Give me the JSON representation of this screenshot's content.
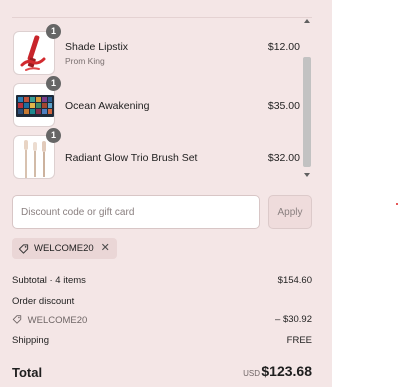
{
  "items": [
    {
      "title": "Shade Lipstix",
      "subtitle": "Prom King",
      "price": "$12.00",
      "quantity": "1"
    },
    {
      "title": "Ocean Awakening",
      "subtitle": "",
      "price": "$35.00",
      "quantity": "1"
    },
    {
      "title": "Radiant Glow Trio Brush Set",
      "subtitle": "",
      "price": "$32.00",
      "quantity": "1"
    }
  ],
  "discount": {
    "placeholder": "Discount code or gift card",
    "apply_label": "Apply",
    "applied_code": "WELCOME20"
  },
  "summary": {
    "subtotal_label": "Subtotal · 4 items",
    "subtotal_value": "$154.60",
    "order_discount_label": "Order discount",
    "discount_code": "WELCOME20",
    "discount_value": "– $30.92",
    "shipping_label": "Shipping",
    "shipping_value": "FREE",
    "total_label": "Total",
    "currency": "USD",
    "total_value": "$123.68"
  },
  "colors": {
    "panel_background": "#f4e6e6",
    "chip_background": "#ead6d6",
    "badge": "#666666"
  }
}
